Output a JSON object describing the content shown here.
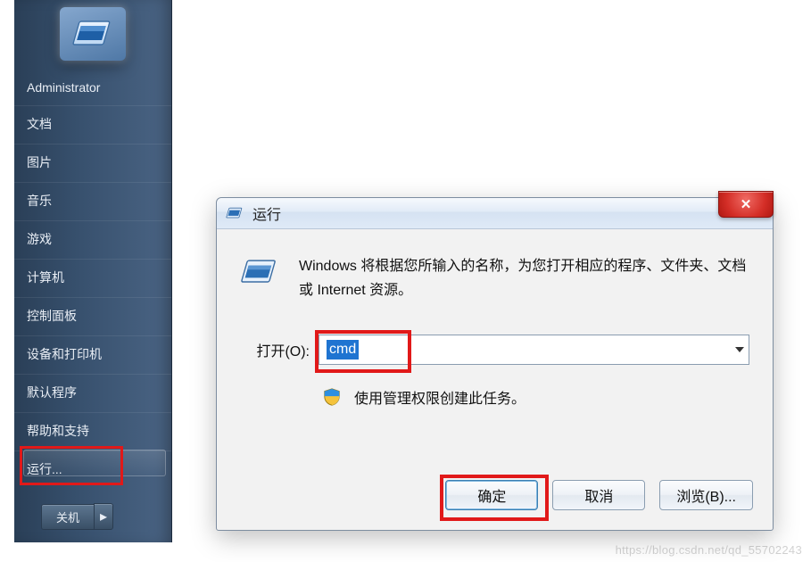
{
  "start": {
    "user": "Administrator",
    "items": [
      "文档",
      "图片",
      "音乐",
      "游戏",
      "计算机",
      "控制面板",
      "设备和打印机",
      "默认程序",
      "帮助和支持",
      "运行..."
    ],
    "shutdown_label": "关机",
    "shutdown_arrow": "▸"
  },
  "run": {
    "title": "运行",
    "description": "Windows 将根据您所输入的名称，为您打开相应的程序、文件夹、文档或 Internet 资源。",
    "open_label": "打开(O):",
    "open_value": "cmd",
    "uac_text": "使用管理权限创建此任务。",
    "ok": "确定",
    "cancel": "取消",
    "browse": "浏览(B)...",
    "close_glyph": "✕"
  },
  "watermark": "https://blog.csdn.net/qd_55702243"
}
